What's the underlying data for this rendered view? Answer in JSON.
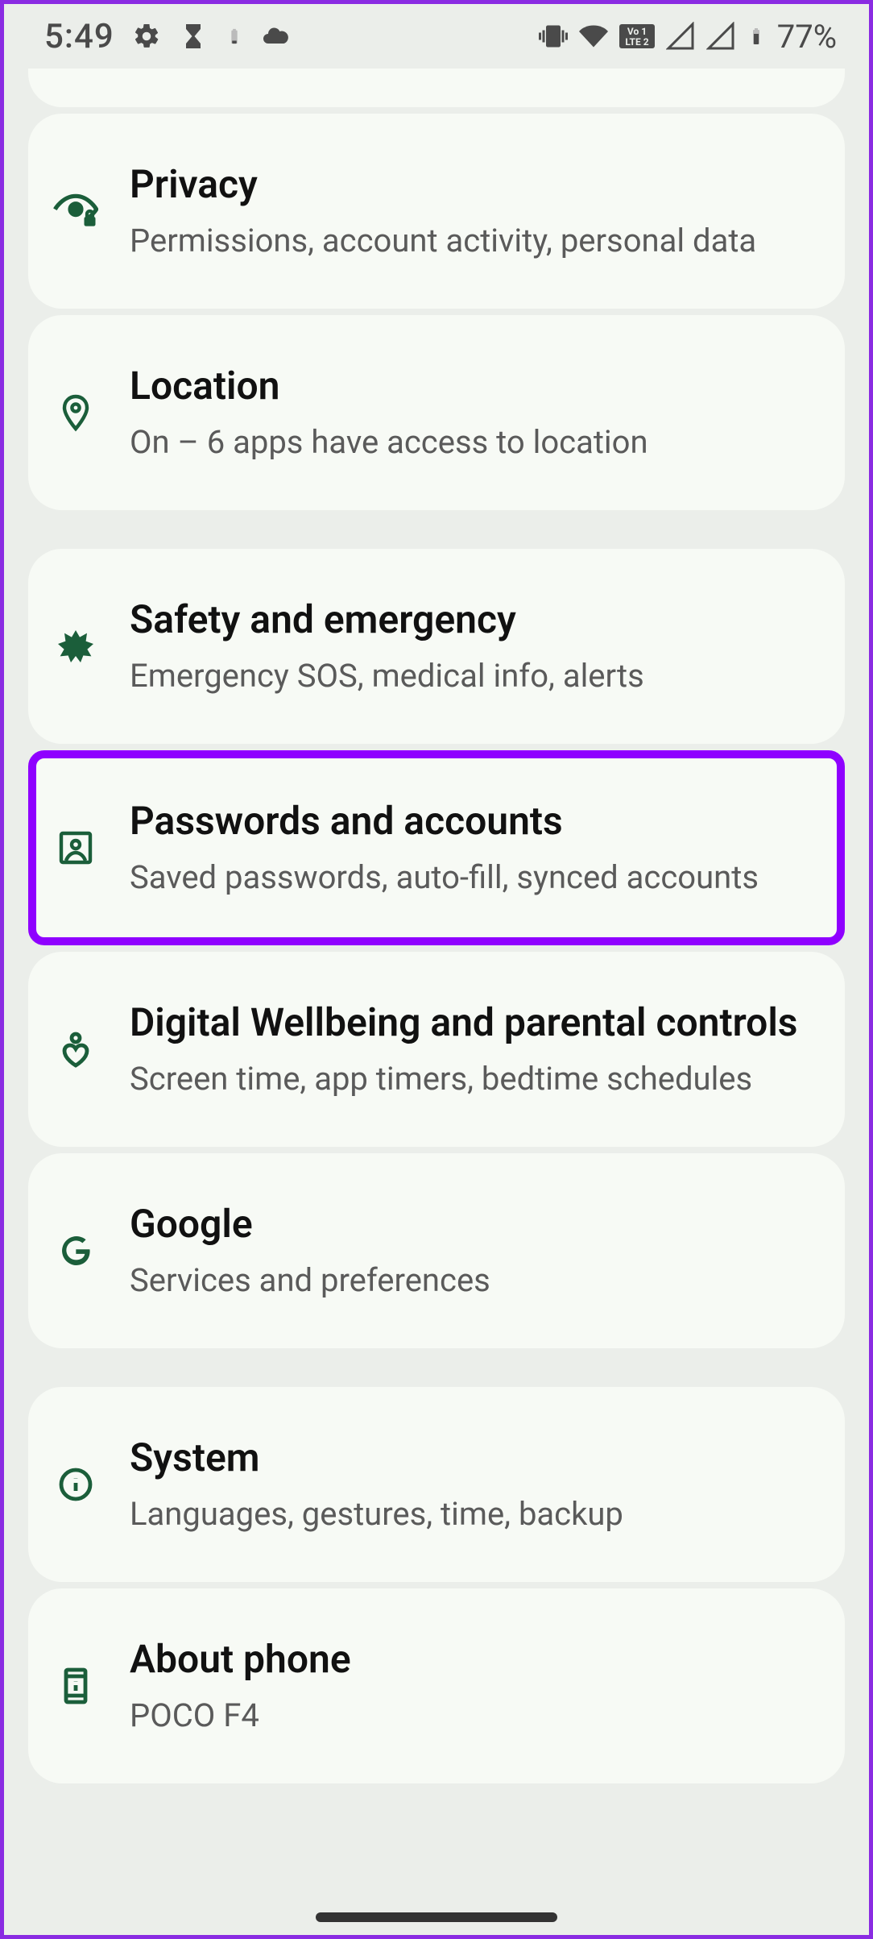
{
  "status": {
    "time": "5:49",
    "battery": "77%"
  },
  "items": [
    {
      "title": "Privacy",
      "subtitle": "Permissions, account activity, personal data"
    },
    {
      "title": "Location",
      "subtitle": "On – 6 apps have access to location"
    },
    {
      "title": "Safety and emergency",
      "subtitle": "Emergency SOS, medical info, alerts"
    },
    {
      "title": "Passwords and accounts",
      "subtitle": "Saved passwords, auto-fill, synced accounts"
    },
    {
      "title": "Digital Wellbeing and parental controls",
      "subtitle": "Screen time, app timers, bedtime schedules"
    },
    {
      "title": "Google",
      "subtitle": "Services and preferences"
    },
    {
      "title": "System",
      "subtitle": "Languages, gestures, time, backup"
    },
    {
      "title": "About phone",
      "subtitle": "POCO F4"
    }
  ]
}
